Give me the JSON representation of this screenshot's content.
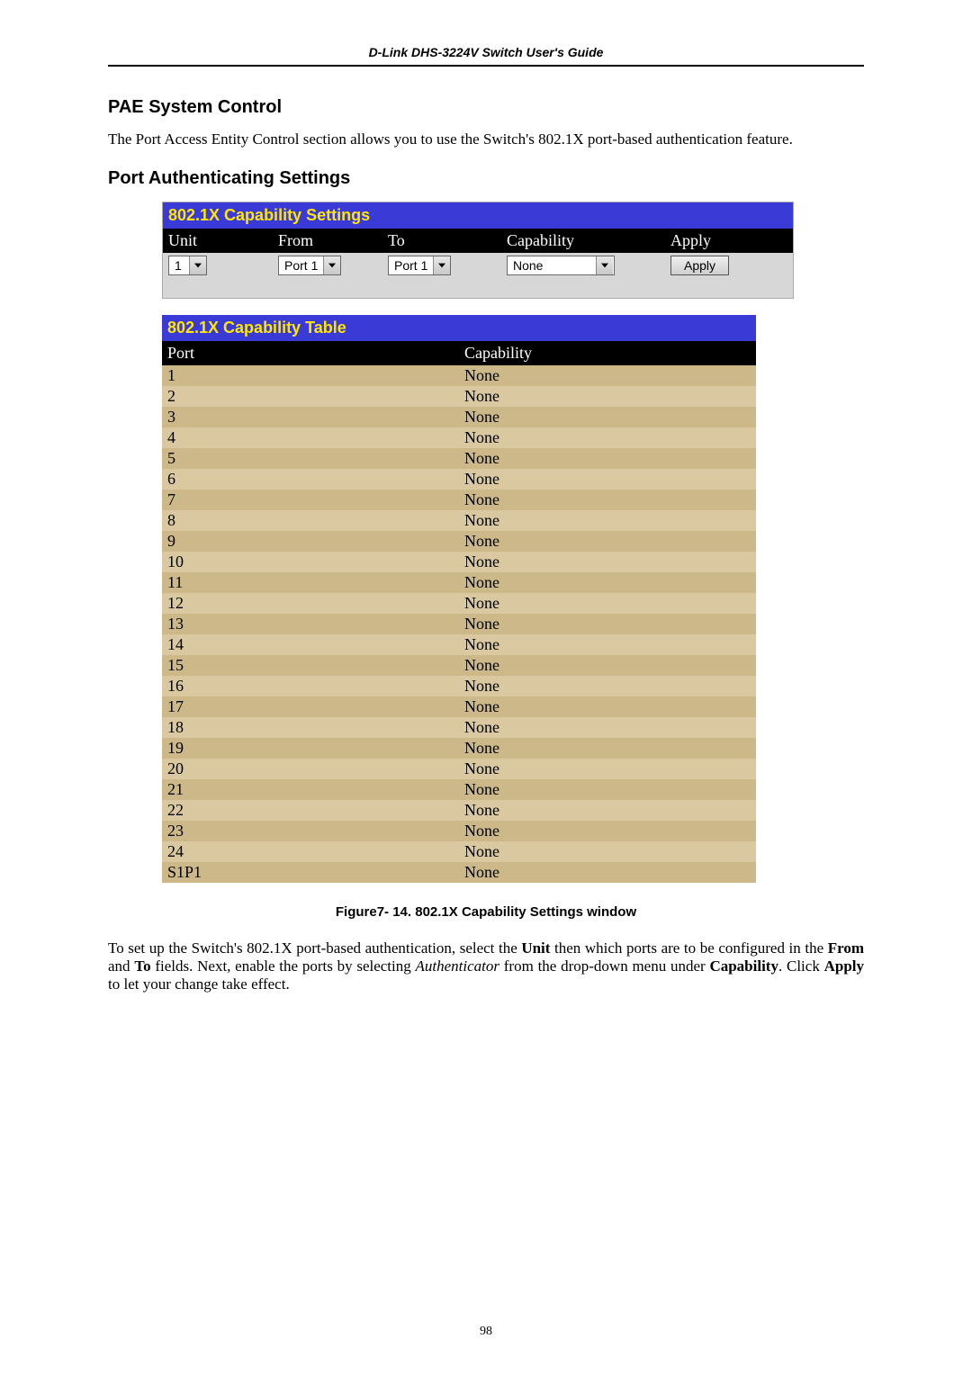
{
  "header": {
    "doc_title": "D-Link DHS-3224V Switch User's Guide"
  },
  "sections": {
    "pae_heading": "PAE System Control",
    "pae_text": "The Port Access Entity Control section allows you to use the Switch's 802.1X port-based authentication feature.",
    "port_auth_heading": "Port Authenticating Settings"
  },
  "settings_panel": {
    "title": "802.1X Capability Settings",
    "cols": {
      "unit": "Unit",
      "from": "From",
      "to": "To",
      "capability": "Capability",
      "apply": "Apply"
    },
    "controls": {
      "unit_value": "1",
      "from_value": "Port 1",
      "to_value": "Port 1",
      "capability_value": "None",
      "apply_label": "Apply"
    }
  },
  "table_panel": {
    "title": "802.1X Capability Table",
    "cols": {
      "port": "Port",
      "capability": "Capability"
    },
    "rows": [
      {
        "port": "1",
        "capability": "None"
      },
      {
        "port": "2",
        "capability": "None"
      },
      {
        "port": "3",
        "capability": "None"
      },
      {
        "port": "4",
        "capability": "None"
      },
      {
        "port": "5",
        "capability": "None"
      },
      {
        "port": "6",
        "capability": "None"
      },
      {
        "port": "7",
        "capability": "None"
      },
      {
        "port": "8",
        "capability": "None"
      },
      {
        "port": "9",
        "capability": "None"
      },
      {
        "port": "10",
        "capability": "None"
      },
      {
        "port": "11",
        "capability": "None"
      },
      {
        "port": "12",
        "capability": "None"
      },
      {
        "port": "13",
        "capability": "None"
      },
      {
        "port": "14",
        "capability": "None"
      },
      {
        "port": "15",
        "capability": "None"
      },
      {
        "port": "16",
        "capability": "None"
      },
      {
        "port": "17",
        "capability": "None"
      },
      {
        "port": "18",
        "capability": "None"
      },
      {
        "port": "19",
        "capability": "None"
      },
      {
        "port": "20",
        "capability": "None"
      },
      {
        "port": "21",
        "capability": "None"
      },
      {
        "port": "22",
        "capability": "None"
      },
      {
        "port": "23",
        "capability": "None"
      },
      {
        "port": "24",
        "capability": "None"
      },
      {
        "port": "S1P1",
        "capability": "None"
      }
    ]
  },
  "figure_caption": "Figure7- 14.  802.1X Capability Settings window",
  "instructions": {
    "pre1": "To set up the Switch's 802.1X port-based authentication, select the ",
    "unit": "Unit",
    "mid1": " then which ports are to be configured in the ",
    "from": "From",
    "mid2": " and ",
    "to": "To",
    "mid3": " fields. Next, enable the ports by selecting ",
    "auth": "Authenticator",
    "mid4": " from the drop-down menu under ",
    "cap": "Capability",
    "mid5": ". Click ",
    "apply": "Apply",
    "mid6": " to let your change take effect."
  },
  "page_number": "98"
}
